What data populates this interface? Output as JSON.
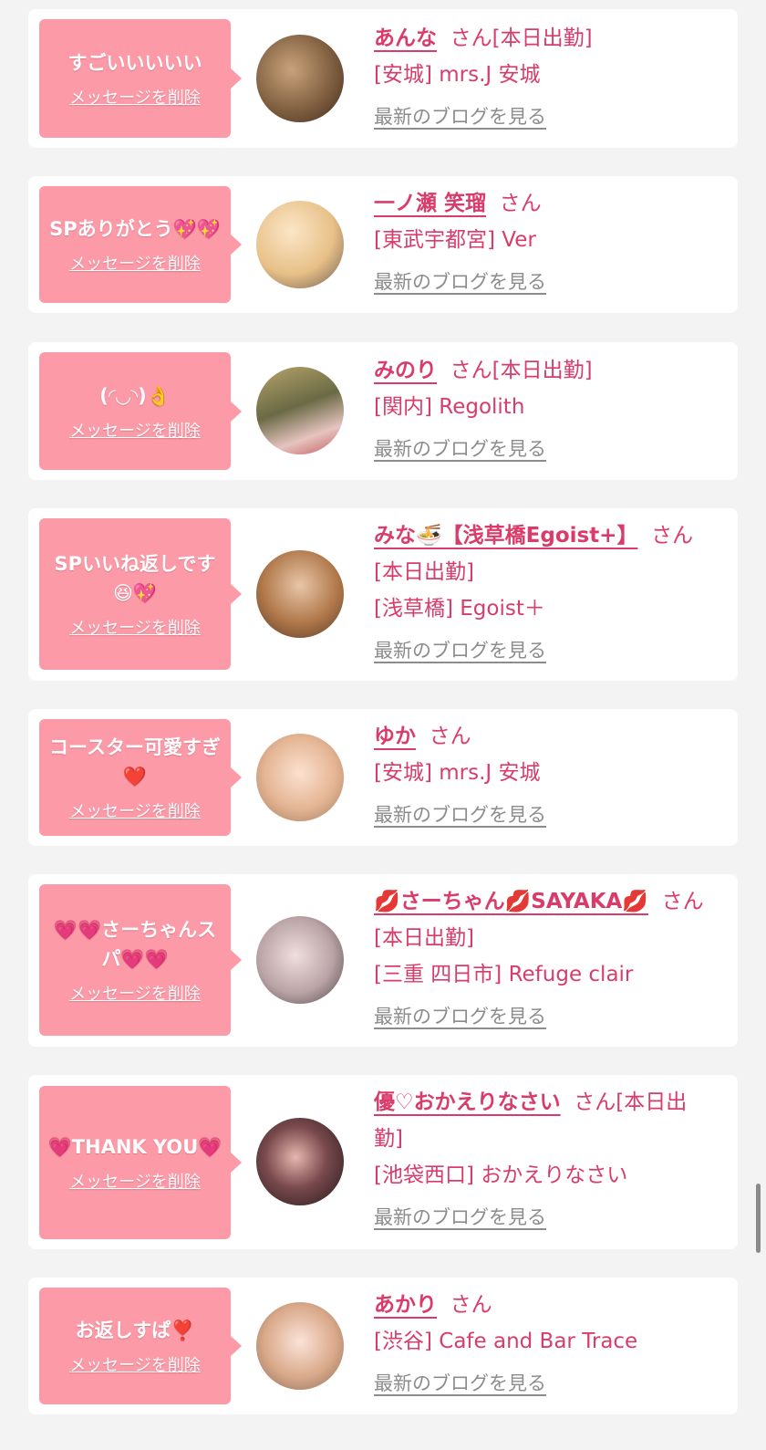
{
  "colors": {
    "bubble": "#fc9aa8",
    "accent": "#d93c6b",
    "blog_link": "#8c8c8c",
    "page_bg": "#f3f3f3"
  },
  "messages": [
    {
      "bubble_text": "すごいいいいい",
      "delete_label": "メッセージを削除",
      "name": "あんな",
      "honorific": "さん",
      "status": "[本日出勤]",
      "shop": "[安城] mrs.J 安城",
      "blog_label": "最新のブログを見る"
    },
    {
      "bubble_text": "SPありがとう💖💖",
      "delete_label": "メッセージを削除",
      "name": "一ノ瀬 笑瑠",
      "honorific": "さん",
      "status": "",
      "shop": "[東武宇都宮] Ver",
      "blog_label": "最新のブログを見る"
    },
    {
      "bubble_text": "(◜◡◝)👌",
      "delete_label": "メッセージを削除",
      "name": "みのり",
      "honorific": "さん",
      "status": "[本日出勤]",
      "shop": "[関内] Regolith",
      "blog_label": "最新のブログを見る"
    },
    {
      "bubble_text": "SPいいね返しです😆💖",
      "delete_label": "メッセージを削除",
      "name": "みな🍜【浅草橋Egoist+】",
      "honorific": "さん",
      "status": "[本日出勤]",
      "shop": "[浅草橋] Egoist＋",
      "blog_label": "最新のブログを見る"
    },
    {
      "bubble_text": "コースター可愛すぎ❤️",
      "delete_label": "メッセージを削除",
      "name": "ゆか",
      "honorific": "さん",
      "status": "",
      "shop": "[安城] mrs.J 安城",
      "blog_label": "最新のブログを見る"
    },
    {
      "bubble_text": "💗💗さーちゃんスパ💗💗",
      "delete_label": "メッセージを削除",
      "name": "💋さーちゃん💋SAYAKA💋",
      "honorific": "さん",
      "status": "[本日出勤]",
      "shop": "[三重 四日市] Refuge clair",
      "blog_label": "最新のブログを見る"
    },
    {
      "bubble_text": "💗THANK YOU💗",
      "delete_label": "メッセージを削除",
      "name": "優♡おかえりなさい",
      "honorific": "さん",
      "status": "[本日出勤]",
      "shop": "[池袋西口] おかえりなさい",
      "blog_label": "最新のブログを見る"
    },
    {
      "bubble_text": "お返しすぱ❣️",
      "delete_label": "メッセージを削除",
      "name": "あかり",
      "honorific": "さん",
      "status": "",
      "shop": "[渋谷] Cafe and Bar Trace",
      "blog_label": "最新のブログを見る"
    }
  ]
}
